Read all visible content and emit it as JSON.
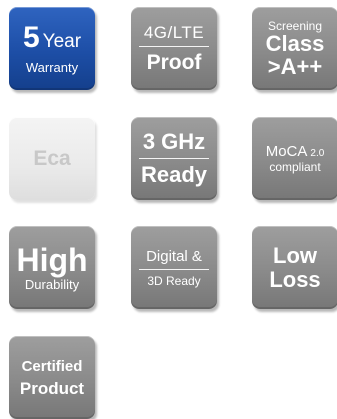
{
  "badges": {
    "warranty": {
      "number": "5",
      "word": "Year",
      "sub": "Warranty"
    },
    "lte": {
      "line1": "4G/LTE",
      "line2": "Proof"
    },
    "screening": {
      "line1": "Screening",
      "line2": "Class",
      "line3": ">A++"
    },
    "eca": {
      "line1": "Eca"
    },
    "ghz": {
      "line1": "3 GHz",
      "line2": "Ready"
    },
    "moca": {
      "line1": "MoCA",
      "version": "2.0",
      "line2": "compliant"
    },
    "durability": {
      "line1": "High",
      "line2": "Durability"
    },
    "digital": {
      "line1": "Digital &",
      "line2": "3D Ready"
    },
    "lowloss": {
      "line1": "Low",
      "line2": "Loss"
    },
    "certified": {
      "line1": "Certified",
      "line2": "Product"
    }
  },
  "colors": {
    "blue_badge": "#1d4ea6",
    "gray_badge": "#8a8a8a",
    "light_badge": "#eaeaea",
    "light_text": "#c8c8c8"
  }
}
